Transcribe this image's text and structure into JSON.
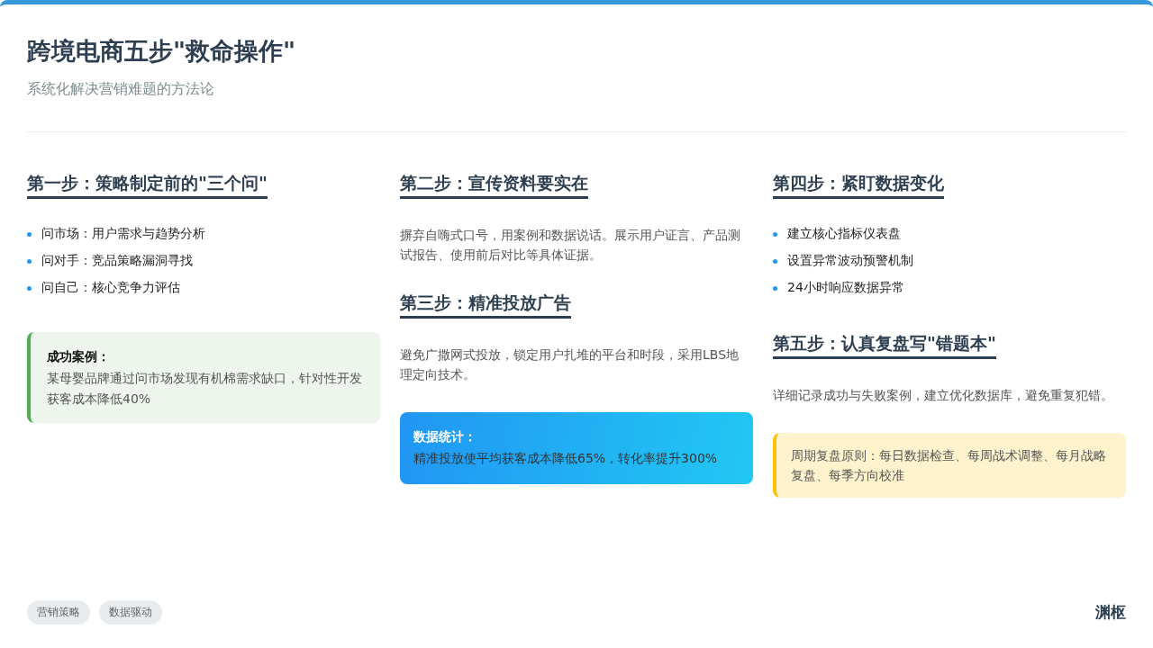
{
  "title": "跨境电商五步\"救命操作\"",
  "subtitle": "系统化解决营销难题的方法论",
  "columns": [
    [
      {
        "kind": "heading",
        "text": "第一步：策略制定前的\"三个问\""
      },
      {
        "kind": "bullets",
        "items": [
          "问市场：用户需求与趋势分析",
          "问对手：竞品策略漏洞寻找",
          "问自己：核心竞争力评估"
        ]
      },
      {
        "kind": "case",
        "title": "成功案例：",
        "text": "某母婴品牌通过问市场发现有机棉需求缺口，针对性开发获客成本降低40%"
      }
    ],
    [
      {
        "kind": "heading",
        "text": "第二步：宣传资料要实在"
      },
      {
        "kind": "paragraph",
        "text": "摒弃自嗨式口号，用案例和数据说话。展示用户证言、产品测试报告、使用前后对比等具体证据。"
      },
      {
        "kind": "heading",
        "text": "第三步：精准投放广告"
      },
      {
        "kind": "paragraph",
        "text": "避免广撒网式投放，锁定用户扎堆的平台和时段，采用LBS地理定向技术。"
      },
      {
        "kind": "stats",
        "title": "数据统计：",
        "text": "精准投放使平均获客成本降低65%，转化率提升300%"
      }
    ],
    [
      {
        "kind": "heading",
        "text": "第四步：紧盯数据变化"
      },
      {
        "kind": "bullets",
        "items": [
          "建立核心指标仪表盘",
          "设置异常波动预警机制",
          "24小时响应数据异常"
        ]
      },
      {
        "kind": "heading",
        "text": "第五步：认真复盘写\"错题本\""
      },
      {
        "kind": "paragraph",
        "text": "详细记录成功与失败案例，建立优化数据库，避免重复犯错。"
      },
      {
        "kind": "note",
        "text": "周期复盘原则：每日数据检查、每周战术调整、每月战略复盘、每季方向校准"
      }
    ]
  ],
  "tags": [
    "营销策略",
    "数据驱动"
  ],
  "brand": "渊枢"
}
